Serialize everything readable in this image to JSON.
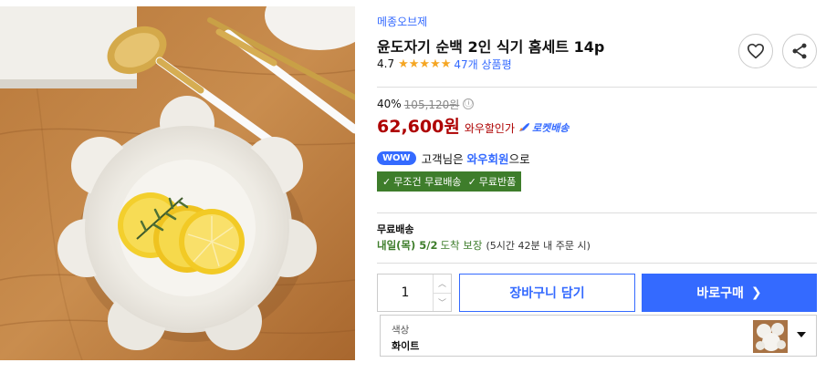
{
  "product_image": {
    "icon": "product-photo-lemon-on-white-plate"
  },
  "brand": "메종오브제",
  "title": "윤도자기 순백 2인 식기 홈세트 14p",
  "rating": {
    "score": "4.7",
    "stars": 5,
    "review_link": "47개 상품평"
  },
  "actions": {
    "wishlist_icon": "heart-icon",
    "share_icon": "share-icon"
  },
  "price": {
    "discount_rate": "40%",
    "original_price": "105,120원",
    "info_icon": "ⓘ",
    "sale_price": "62,600원",
    "sale_label": "와우할인가",
    "rocket_label": "로켓배송"
  },
  "wow": {
    "badge": "WOW",
    "text_prefix": "고객님은 ",
    "member": "와우회원",
    "text_suffix": "으로"
  },
  "benefits": [
    "무조건 무료배송",
    "무료반품"
  ],
  "shipping": {
    "title": "무료배송",
    "date": "내일(목) 5/2",
    "guarantee": "도착 보장",
    "note": "(5시간 42분 내 주문 시)"
  },
  "quantity": {
    "value": "1"
  },
  "buttons": {
    "cart": "장바구니 담기",
    "buy": "바로구매"
  },
  "option": {
    "label": "색상",
    "value": "화이트"
  },
  "colors": {
    "accent": "#346aff",
    "price": "#ae0000",
    "benefit_green": "#3e7d2b",
    "star": "#f5a623"
  }
}
